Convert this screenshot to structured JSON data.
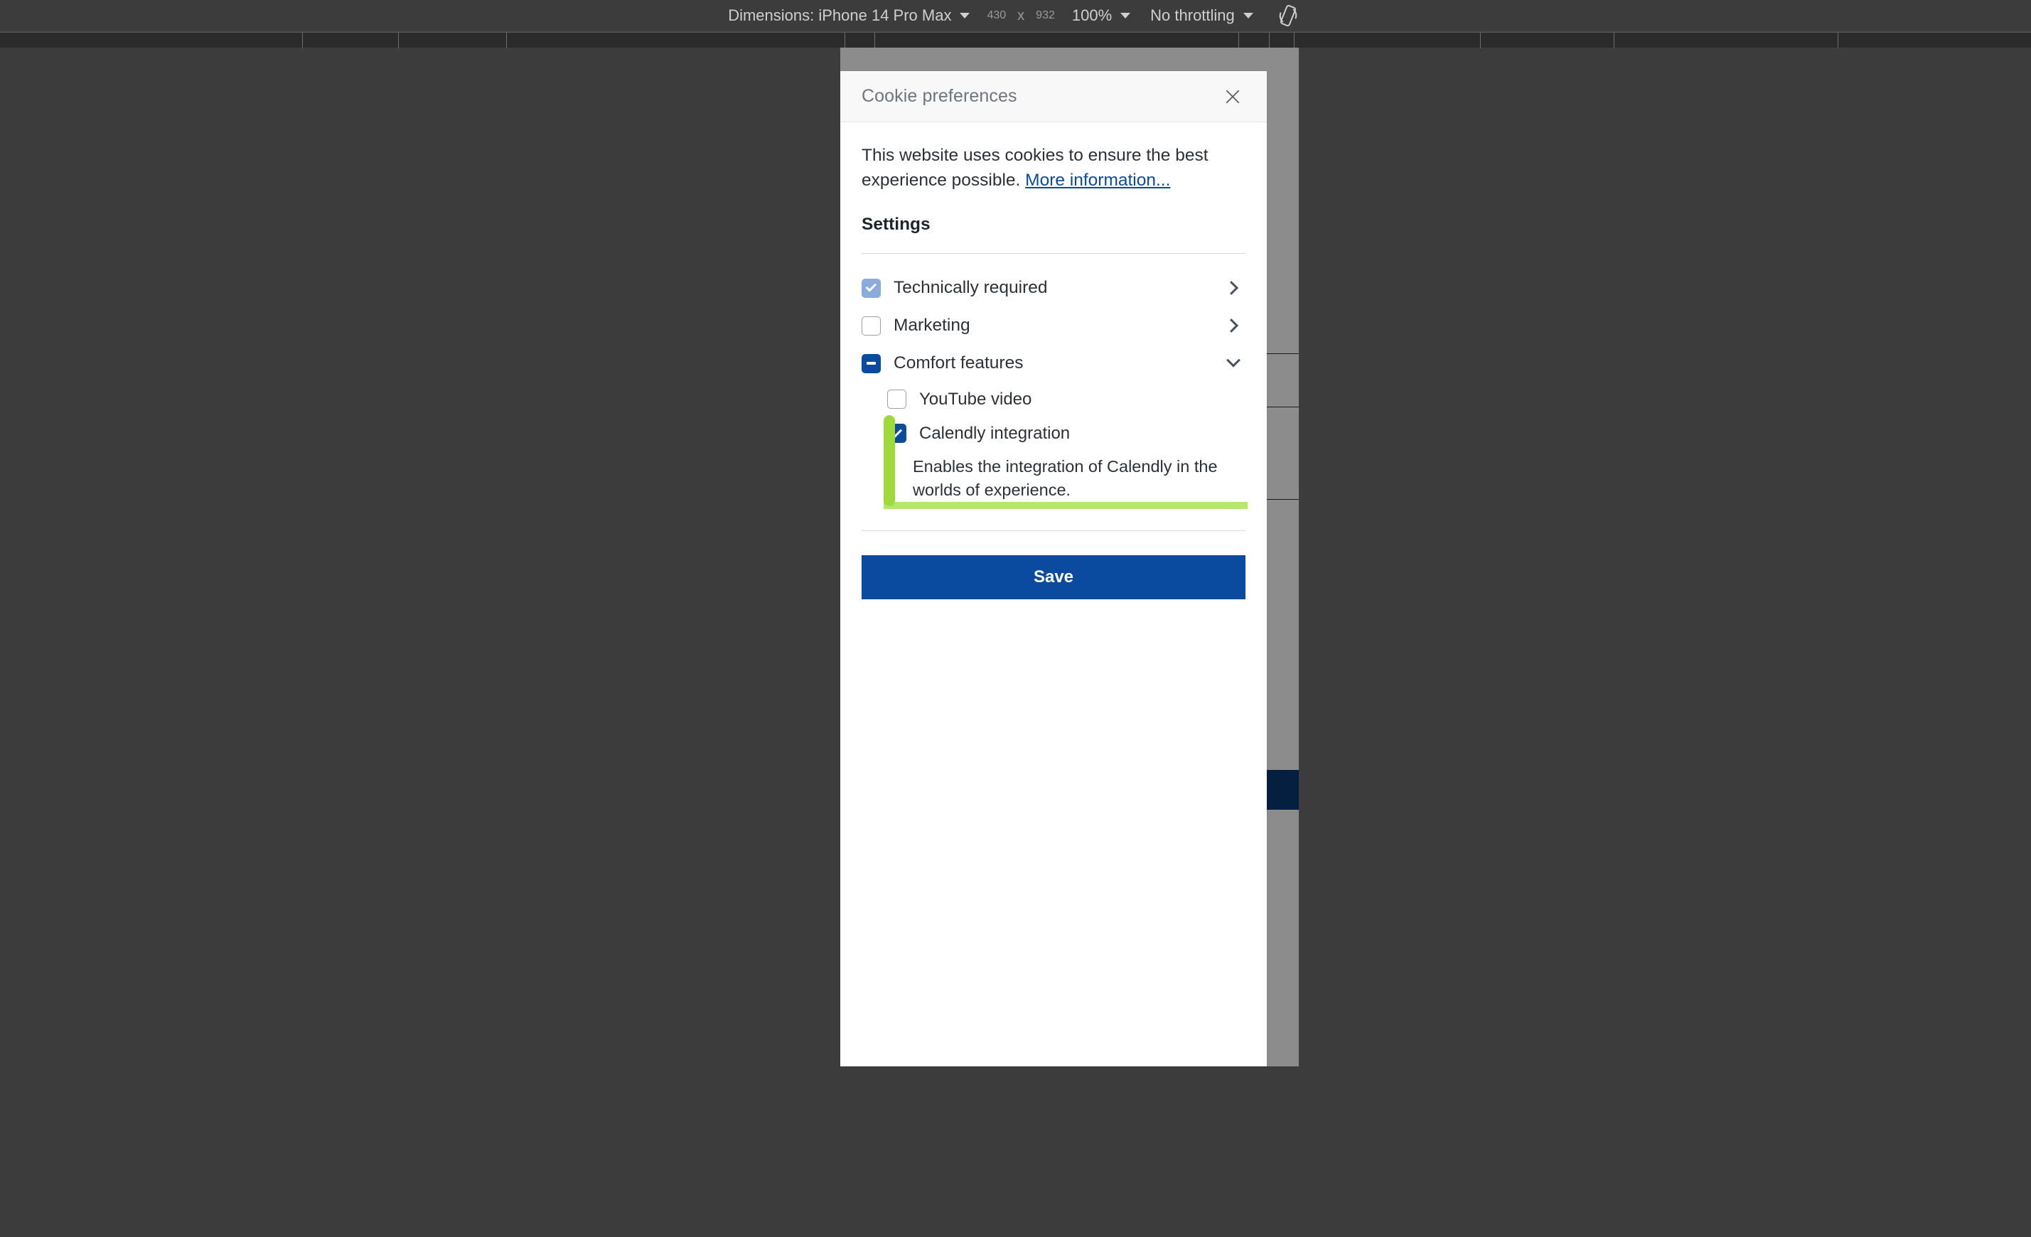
{
  "devtools_toolbar": {
    "dimensions_label": "Dimensions: iPhone 14 Pro Max",
    "width_value": "430",
    "separator": "x",
    "height_value": "932",
    "zoom_value": "100%",
    "throttling_value": "No throttling",
    "rotate_icon": "rotate-device-icon",
    "ruler_ticks": [
      425,
      560,
      712,
      1188,
      1230,
      1742,
      1785,
      1820,
      2082,
      2270,
      2585
    ]
  },
  "dialog": {
    "title": "Cookie preferences",
    "close_icon": "close-icon",
    "intro_text": "This website uses cookies to ensure the best experience possible. ",
    "more_info_link": "More information...",
    "settings_heading": "Settings",
    "categories": [
      {
        "label": "Technically required",
        "checkbox_state": "checked-disabled",
        "expand_icon": "chevron-right-icon"
      },
      {
        "label": "Marketing",
        "checkbox_state": "unchecked",
        "expand_icon": "chevron-right-icon"
      },
      {
        "label": "Comfort features",
        "checkbox_state": "indeterminate",
        "expand_icon": "chevron-down-icon",
        "children": [
          {
            "label": "YouTube video",
            "checkbox_state": "unchecked"
          },
          {
            "label": "Calendly integration",
            "checkbox_state": "checked",
            "description": "Enables the integration of Calendly in the worlds of experience."
          }
        ]
      }
    ],
    "save_label": "Save"
  },
  "annotation": {
    "vertical_mark_color": "#9edb38",
    "horizontal_mark_color": "#b5e86a"
  },
  "background_page": {
    "divider_rows": [
      430,
      505,
      635
    ],
    "dash_marks": [
      472,
      600
    ],
    "button_color": "#0a3a75"
  },
  "colors": {
    "accent_blue": "#0a4ba0",
    "muted_blue": "#8aabdb",
    "toolbar_bg": "#3c3c3c",
    "header_bg": "#f8f8f8",
    "text": "#2c3138",
    "title_text": "#6e7480"
  }
}
